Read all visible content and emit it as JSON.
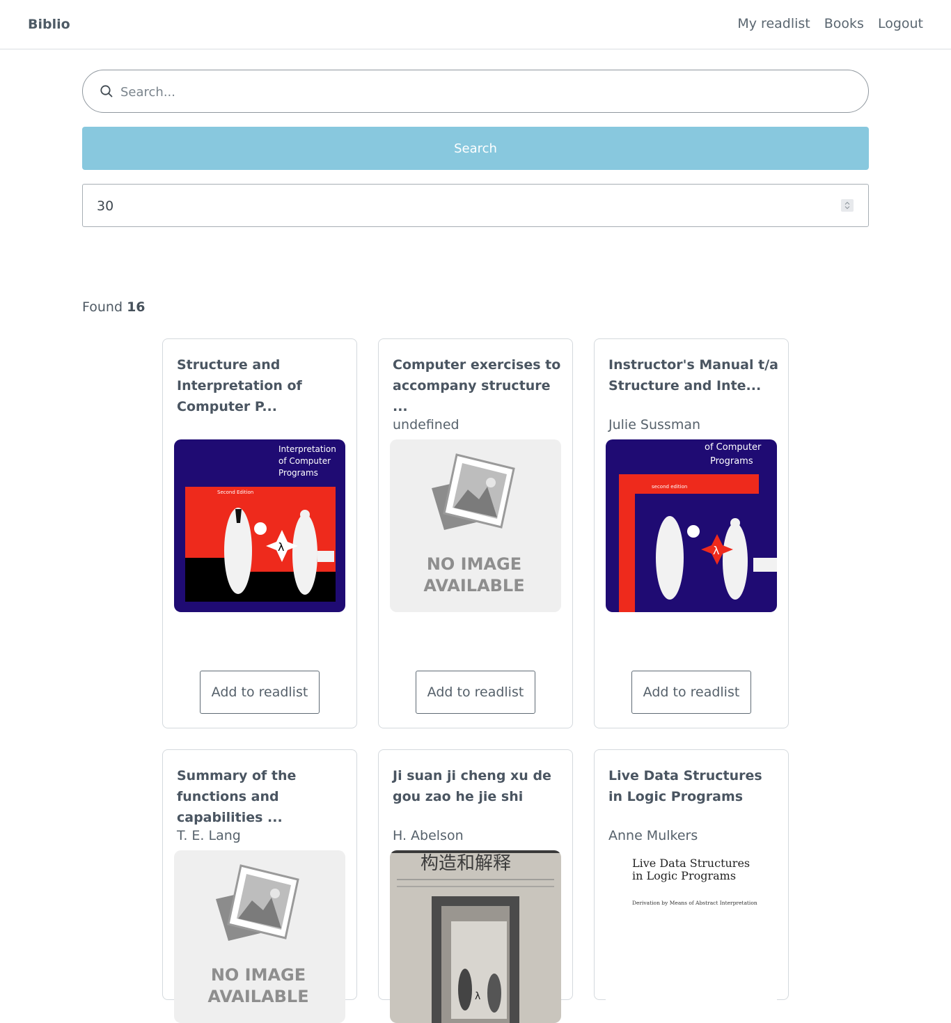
{
  "nav": {
    "brand": "Biblio",
    "links": [
      "My readlist",
      "Books",
      "Logout"
    ]
  },
  "search": {
    "placeholder": "Search...",
    "button_label": "Search",
    "limit_value": "30"
  },
  "results": {
    "found_label": "Found",
    "found_count": "16"
  },
  "books": [
    {
      "title": "Structure and Interpretation of Computer P...",
      "author": "",
      "cover": "sicp-cover",
      "action": "Add to readlist"
    },
    {
      "title": "Computer exercises to accompany structure ...",
      "author": "undefined",
      "cover": "no-image-available",
      "action": "Add to readlist"
    },
    {
      "title": "Instructor's Manual t/a Structure and Inte...",
      "author": "Julie Sussman",
      "cover": "sicp-second-edition-cover",
      "action": "Add to readlist"
    },
    {
      "title": "Summary of the functions and capabilities ...",
      "author": "T. E. Lang",
      "cover": "no-image-available",
      "action": ""
    },
    {
      "title": "Ji suan ji cheng xu de gou zao he jie shi",
      "author": "H. Abelson",
      "cover": "chinese-edition-cover",
      "action": ""
    },
    {
      "title": "Live Data Structures in Logic Programs",
      "author": "Anne Mulkers",
      "cover": "live-data-structures-cover",
      "action": ""
    }
  ],
  "covers": {
    "sicp_lines": [
      "Interpretation",
      "of Computer",
      "Programs"
    ],
    "sicp_edition": "Second Edition",
    "sicp2_lines": [
      "of Computer",
      "Programs"
    ],
    "sicp2_edition": "second edition",
    "noimg_line1": "NO IMAGE",
    "noimg_line2": "AVAILABLE",
    "chinese_title": "构造和解释",
    "live_title_1": "Live Data Structures",
    "live_title_2": "in Logic Programs",
    "live_subtitle": "Derivation by Means of Abstract Interpretation"
  },
  "colors": {
    "accent": "#88c8de",
    "cover_blue": "#1f0b73",
    "cover_red": "#ee2a1c"
  }
}
